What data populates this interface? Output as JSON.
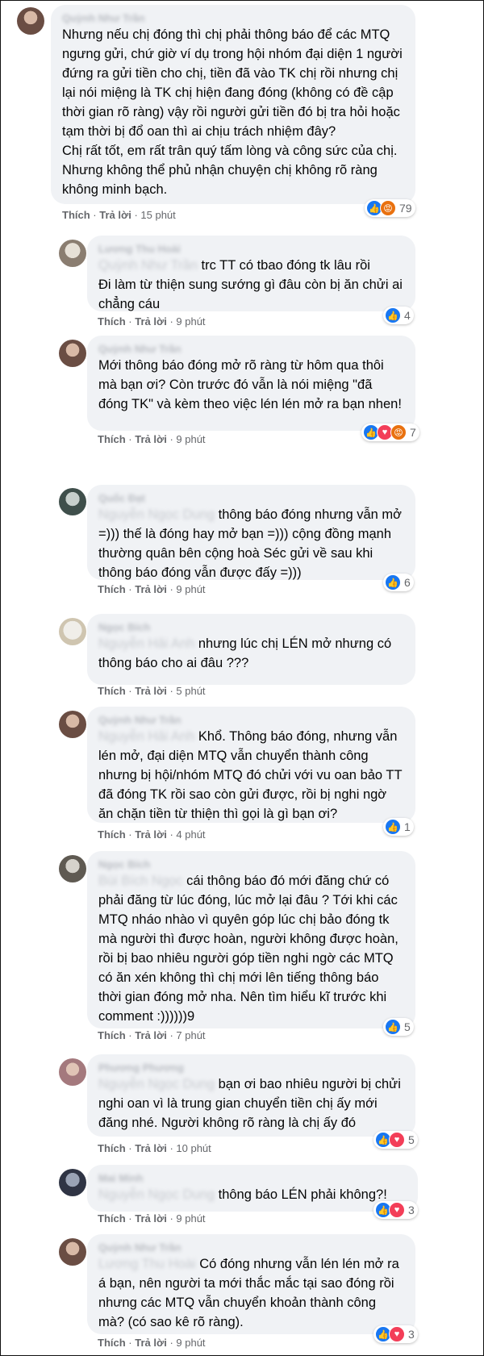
{
  "labels": {
    "like": "Thích",
    "reply": "Trả lời"
  },
  "comments": [
    {
      "author": "Quỳnh Như Trần",
      "reply_to": "",
      "text": "Nhưng nếu chị đóng thì chị phải thông báo để các MTQ ngưng gửi, chứ giờ ví dụ trong hội nhóm đại diện 1 người đứng ra gửi tiền cho chị, tiền đã vào TK chị rồi nhưng chị lại nói miệng là TK chị hiện đang đóng (không có đề cập thời gian rõ ràng) vậy rồi người gửi tiền đó bị tra hỏi hoặc tạm thời bị đổ oan thì ai chịu trách nhiệm đây?\nChị rất tốt, em rất trân quý tấm lòng và công sức của chị. Nhưng không thể phủ nhận chuyện chị không rõ ràng không minh bạch.",
      "time": "15 phút",
      "reactions": [
        "like-icon",
        "angry-icon"
      ],
      "count": "79"
    },
    {
      "author": "Lương Thu Hoài",
      "reply_to": "Quỳnh Như Trần",
      "text": "trc TT có tbao đóng tk lâu rồi\nĐi làm từ thiện sung sướng gì đâu còn bị ăn chửi ai chẳng cáu",
      "time": "9 phút",
      "reactions": [
        "like-icon"
      ],
      "count": "4"
    },
    {
      "author": "Quỳnh Như Trần",
      "reply_to": "",
      "text": "Mới thông báo đóng mở rõ ràng từ hôm qua thôi mà bạn ơi? Còn trước đó vẫn là nói miệng \"đã đóng TK\" và kèm theo việc lén lén mở ra bạn nhen!",
      "time": "9 phút",
      "reactions": [
        "like-icon",
        "love-icon",
        "angry-icon"
      ],
      "count": "7"
    },
    {
      "author": "Quốc Đạt",
      "reply_to": "Nguyễn Ngọc Dung",
      "text": "thông báo đóng nhưng vẫn mở =))) thế là đóng hay mở bạn =))) cộng đồng mạnh thường quân bên cộng hoà Séc gửi về sau khi thông báo đóng vẫn được đấy =)))",
      "time": "9 phút",
      "reactions": [
        "like-icon"
      ],
      "count": "6"
    },
    {
      "author": "Ngọc Bích",
      "reply_to": "Nguyễn Hải Anh",
      "text": "nhưng lúc chị LÉN mở nhưng có thông báo cho ai đâu ???",
      "time": "5 phút",
      "reactions": [],
      "count": ""
    },
    {
      "author": "Quỳnh Như Trần",
      "reply_to": "Nguyễn Hải Anh",
      "text": "Khổ. Thông báo đóng, nhưng vẫn lén mở, đại diện MTQ vẫn chuyển thành công nhưng bị hội/nhóm MTQ đó chửi với vu oan bảo TT đã đóng TK rồi sao còn gửi được, rồi bị nghi ngờ ăn chặn tiền từ thiện thì gọi là gì bạn ơi?",
      "time": "4 phút",
      "reactions": [
        "like-icon"
      ],
      "count": "1"
    },
    {
      "author": "Ngọc Bích",
      "reply_to": "Bùi Bích Ngọc",
      "text": "cái thông báo đó mới đăng chứ có phải đăng từ lúc đóng, lúc mở lại đâu ? Tới khi các MTQ nháo nhào vì quyên góp lúc chị bảo đóng tk mà người thì được hoàn, người không được hoàn, rồi bị bao nhiêu người góp tiền nghi ngờ các MTQ có ăn xén không thì chị mới lên tiếng thông báo thời gian đóng mở nha. Nên tìm hiểu kĩ trước khi comment :))))))9",
      "time": "7 phút",
      "reactions": [
        "like-icon"
      ],
      "count": "5"
    },
    {
      "author": "Phương Phương",
      "reply_to": "Nguyễn Ngọc Dung",
      "text": "bạn ơi bao nhiêu người bị chửi nghi oan vì là trung gian chuyển tiền chị ấy mới đăng nhé. Người không rõ ràng là chị ấy đó",
      "time": "10 phút",
      "reactions": [
        "like-icon",
        "love-icon"
      ],
      "count": "5"
    },
    {
      "author": "Mai Minh",
      "reply_to": "Nguyễn Ngọc Dung",
      "text": "thông báo LÉN phải không?!",
      "time": "9 phút",
      "reactions": [
        "like-icon",
        "love-icon"
      ],
      "count": "3"
    },
    {
      "author": "Quỳnh Như Trần",
      "reply_to": "Lương Thu Hoài",
      "text": "Có đóng nhưng vẫn lén lén mở ra á bạn, nên người ta mới thắc mắc tại sao đóng rồi nhưng các MTQ vẫn chuyển khoản thành công mà? (có sao kê rõ ràng).",
      "time": "9 phút",
      "reactions": [
        "like-icon",
        "love-icon"
      ],
      "count": "3"
    }
  ]
}
